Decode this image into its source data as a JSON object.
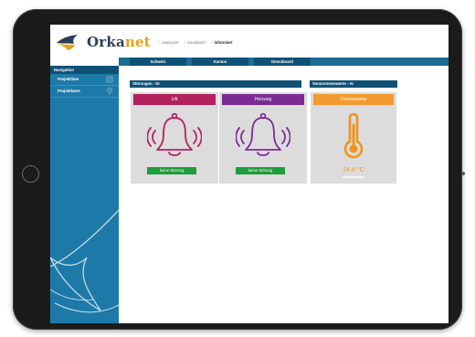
{
  "brand": {
    "name_part1": "Orka",
    "name_part2": "net",
    "tagline": [
      "analysiert",
      "visualisiert",
      "informiert"
    ],
    "colors": {
      "navy": "#2a3f57",
      "orange": "#e5a312"
    }
  },
  "topnav": {
    "tabs": [
      "Schweiz",
      "Kanton",
      "Demoboard"
    ]
  },
  "sidebar": {
    "heading": "Navigation",
    "items": [
      {
        "label": "Projektliste",
        "icon": "list-icon"
      },
      {
        "label": "Projektkarte",
        "icon": "map-pin-icon"
      }
    ]
  },
  "panels": {
    "stoerungen": {
      "title": "Störungen - DI",
      "cards": [
        {
          "title": "Lift",
          "color": "#b3205e",
          "icon": "bell-ringing-icon",
          "status": "keine Störung"
        },
        {
          "title": "Heizung",
          "color": "#7b2c94",
          "icon": "bell-ringing-icon",
          "status": "keine Störung"
        }
      ]
    },
    "sensoren": {
      "title": "Sensormesswerte - AI",
      "cards": [
        {
          "title": "Thermometer",
          "color": "#f29a2e",
          "icon": "thermometer-icon",
          "value": "24.6 °C"
        }
      ]
    }
  },
  "colors": {
    "sidebar": "#1d7aa8",
    "header_dark": "#0f5175",
    "status_ok": "#1f9c3c",
    "card_bg": "#dcdcdc"
  }
}
